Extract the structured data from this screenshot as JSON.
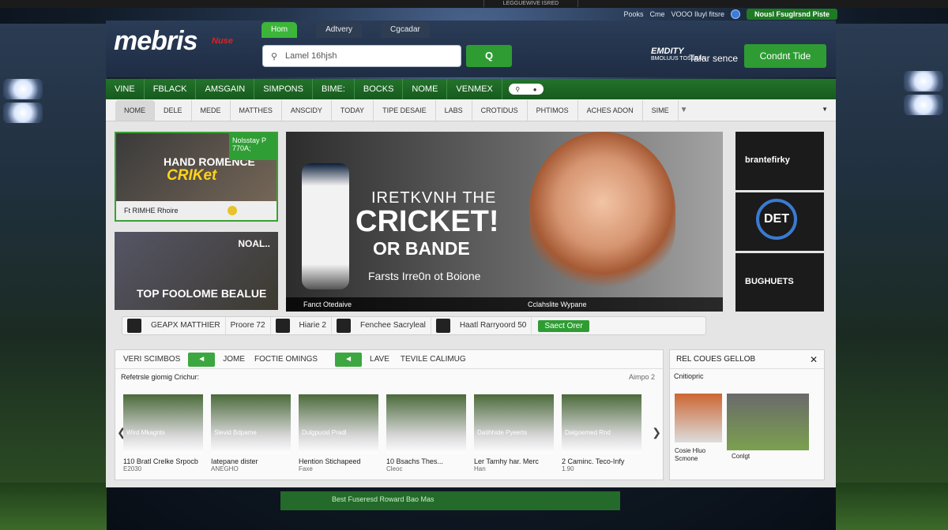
{
  "browser": {
    "title": "LEGGUEWIVE ISRED",
    "right": [
      "Pooks",
      "Cme",
      "VOOO Iluyl fitsre"
    ],
    "button": "Nousl Fsuglrsnd Piste"
  },
  "header": {
    "logo": "mebris",
    "logo_mark": "Nuse",
    "tabs": [
      "Hom",
      "Adtvery",
      "Cgcadar"
    ],
    "search": {
      "value": "Lamel 16hjsh"
    },
    "search_button": "Q",
    "promo": {
      "big": "EMDITY",
      "small": "BMOLUUS TOSSEAN",
      "text": "Tafar sence"
    },
    "cta": "Condnt Tide"
  },
  "navbar": [
    "VINE",
    "FBLACK",
    "AMSGAIN",
    "SIMPONS",
    "BIME:",
    "BOCKS",
    "NOME",
    "VENMEX"
  ],
  "subnav": [
    "NOME",
    "DELE",
    "MEDE",
    "MATTHES",
    "ANSCIDY",
    "TODAY",
    "TIPE DESAIE",
    "LABS",
    "CROTIDUS",
    "PHTIMOS",
    "ACHES ADON",
    "SIME"
  ],
  "cards": {
    "card1": {
      "sub": "HAND ROMENCE",
      "title": "CRIKet",
      "badge": "Nolsstay P 770A;",
      "foot": "Ft RIMHE Rhoire"
    },
    "card2": {
      "badge": "NOAL..",
      "title": "TOP FOOLOME BEALUE"
    }
  },
  "hero": {
    "line1": "IRETKVNH THE",
    "line2": "CRICKET!",
    "line3": "OR BANDE",
    "line4": "Farsts Irre0n ot Boione",
    "foot_left": "Fanct Otedaive",
    "foot_right": "Cclahslite Wypane"
  },
  "side_tiles": [
    "brantefirky",
    "DET",
    "BUGHUETS"
  ],
  "matchbar": [
    "GEAPX MATTHIER",
    "Proore 72",
    "Hiarie 2",
    "Fenchee Sacryleal",
    "Haatl Rarryoord 50"
  ],
  "match_cta": "Saect Orer",
  "section": {
    "head": [
      "VERI SCIMBOS",
      "JOME",
      "FOCTIE OMINGS",
      "LAVE",
      "TEVILE CALIMUG"
    ],
    "subtitle": "Refetrsle giomig Crichur:",
    "subtitle_right": "Aimpo 2",
    "thumbs": [
      {
        "label": "Wird Mkagnts",
        "caption": "110 Bratl Crelke Srpocb",
        "small": "E2030"
      },
      {
        "label": "Slevid Bdpame",
        "caption": "Iatepane dister",
        "small": "ANEGHO"
      },
      {
        "label": "Dulgpuosl Pradl",
        "caption": "Hention Stichapeed",
        "small": "Faxe"
      },
      {
        "label": "",
        "caption": "10 Bsachs Thes...",
        "small": "Cleoc"
      },
      {
        "label": "Datihhide Pyeerts",
        "caption": "Ler Tamhy har. Merc",
        "small": "Han"
      },
      {
        "label": "Dalgoemed Rnd",
        "caption": "2 Caminc. Teco-Infy",
        "small": "1.90"
      }
    ]
  },
  "sideblock": {
    "title": "REL COUES GELLOB",
    "sub": "Cnitiopric",
    "cap1": "Cosie Hluo",
    "cap1b": "Scmone",
    "cap2": "Conlgt"
  },
  "footer": {
    "text": "Best Fuseresd Roward Bao Mas"
  }
}
